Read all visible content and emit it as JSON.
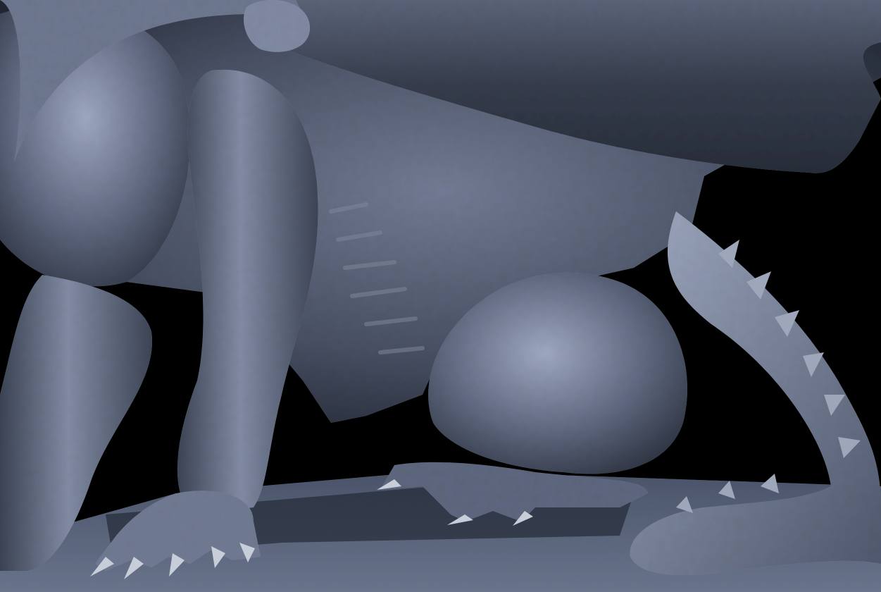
{
  "scene": {
    "subject": "dragon-sculpt-render",
    "colors": {
      "background": "#000000",
      "ground": "#5a6478",
      "body_dark": "#2a303d",
      "body_mid": "#4e5669",
      "body_light": "#8a93a8",
      "highlight": "#b4bccd",
      "wing": "#3a414f"
    }
  }
}
